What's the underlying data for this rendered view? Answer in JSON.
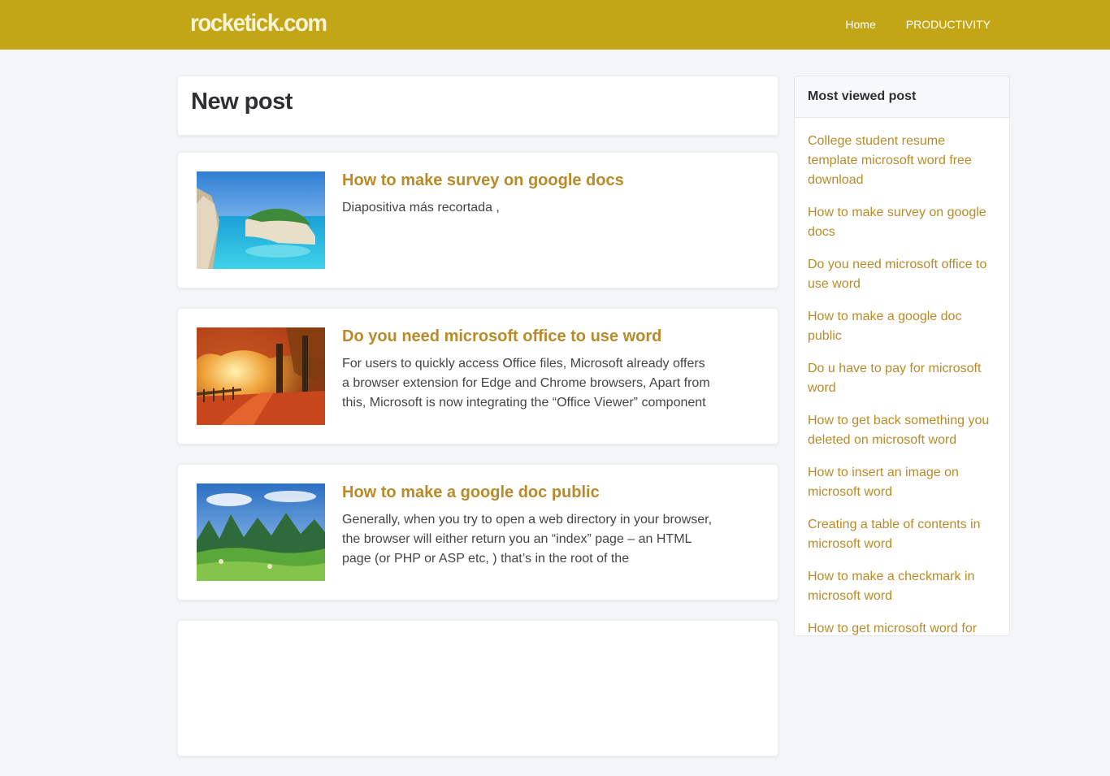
{
  "site": {
    "logo": "rocketick.com"
  },
  "nav": {
    "home": "Home",
    "productivity": "PRODUCTIVITY"
  },
  "main": {
    "heading": "New post",
    "posts": [
      {
        "title": "How to make survey on google docs",
        "excerpt": "Diapositiva más recortada ,",
        "image": "coastal-cliff-beach-photo"
      },
      {
        "title": "Do you need microsoft office to use word",
        "excerpt": "For users to quickly access Office files, Microsoft already offers a browser extension for Edge and Chrome browsers, Apart from this, Microsoft is now integrating the “Office Viewer” component",
        "image": "autumn-forest-path-photo"
      },
      {
        "title": "How to make a google doc public",
        "excerpt": "Generally, when you try to open a web directory in your browser, the browser will either return you an “index” page – an HTML page (or PHP or ASP etc, ) that’s in the root of the",
        "image": "green-mountain-valley-photo"
      }
    ]
  },
  "sidebar": {
    "title": "Most viewed post",
    "items": [
      "College student resume template microsoft word free download",
      "How to make survey on google docs",
      "Do you need microsoft office to use word",
      "How to make a google doc public",
      "Do u have to pay for microsoft word",
      "How to get back something you deleted on microsoft word",
      "How to insert an image on microsoft word",
      "Creating a table of contents in microsoft word",
      "How to make a checkmark in microsoft word",
      "How to get microsoft word for"
    ]
  },
  "colors": {
    "header": "#c2a616",
    "link": "#b88a2a",
    "background": "#f4f5f7"
  }
}
